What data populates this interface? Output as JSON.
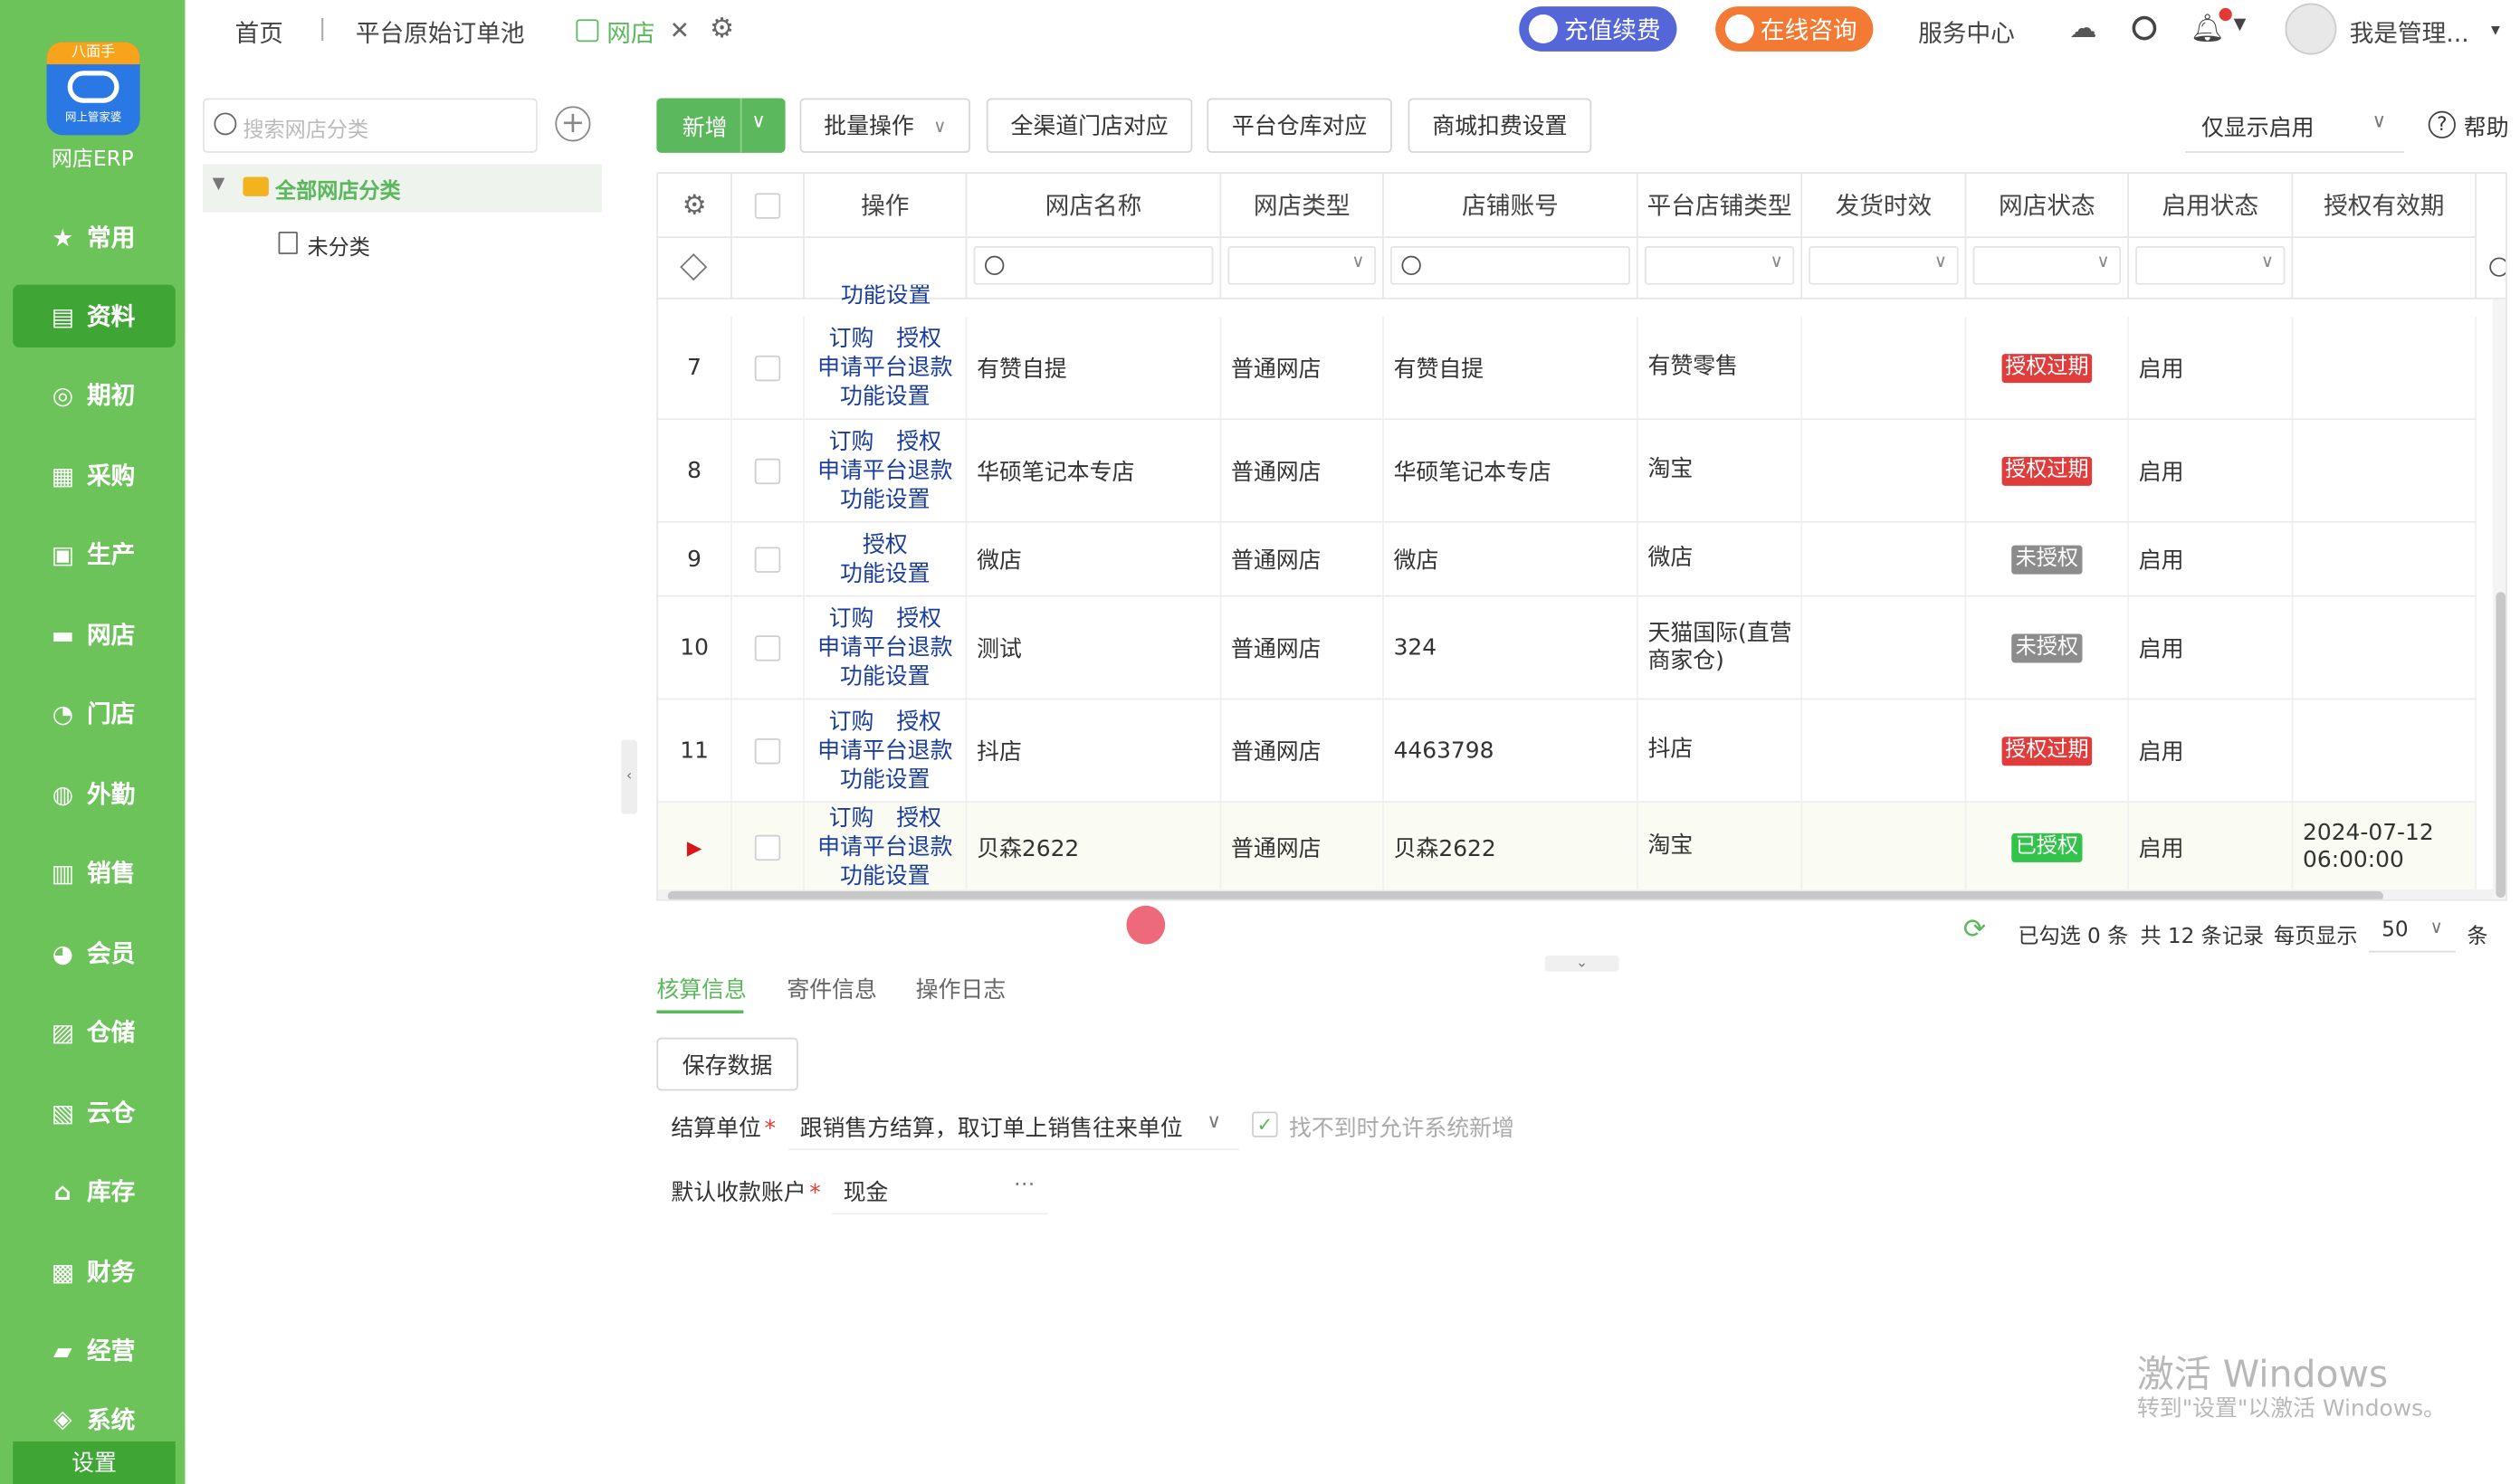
{
  "app": {
    "badge": "八面手",
    "logo_sub": "网上管家婆",
    "title": "网店ERP"
  },
  "sidebar": {
    "items": [
      "常用",
      "资料",
      "期初",
      "采购",
      "生产",
      "网店",
      "门店",
      "外勤",
      "销售",
      "会员",
      "仓储",
      "云仓",
      "库存",
      "财务",
      "经营",
      "系统"
    ],
    "settings": "设置"
  },
  "topbar": {
    "home": "首页",
    "tab_orders": "平台原始订单池",
    "tab_shop": "网店",
    "recharge": "充值续费",
    "consult": "在线咨询",
    "service": "服务中心",
    "user": "我是管理..."
  },
  "tree": {
    "search_placeholder": "搜索网店分类",
    "root": "全部网店分类",
    "child": "未分类"
  },
  "toolbar": {
    "add": "新增",
    "batch": "批量操作",
    "map_store": "全渠道门店对应",
    "map_warehouse": "平台仓库对应",
    "mall_fee": "商城扣费设置",
    "filter_select": "仅显示启用",
    "help": "帮助"
  },
  "columns": [
    "操作",
    "网店名称",
    "网店类型",
    "店铺账号",
    "平台店铺类型",
    "发货时效",
    "网店状态",
    "启用状态",
    "授权有效期"
  ],
  "partial_row_text": "功能设置",
  "rows": [
    {
      "no": "7",
      "ops": [
        "订购",
        "授权",
        "申请平台退款",
        "功能设置"
      ],
      "name": "有赞自提",
      "type": "普通网店",
      "account": "有赞自提",
      "platform": "有赞零售",
      "status": "授权过期",
      "enabled": "启用",
      "expiry": ""
    },
    {
      "no": "8",
      "ops": [
        "订购",
        "授权",
        "申请平台退款",
        "功能设置"
      ],
      "name": "华硕笔记本专店",
      "type": "普通网店",
      "account": "华硕笔记本专店",
      "platform": "淘宝",
      "status": "授权过期",
      "enabled": "启用",
      "expiry": ""
    },
    {
      "no": "9",
      "ops": [
        "",
        "授权",
        "",
        "功能设置"
      ],
      "name": "微店",
      "type": "普通网店",
      "account": "微店",
      "platform": "微店",
      "status": "未授权",
      "enabled": "启用",
      "expiry": ""
    },
    {
      "no": "10",
      "ops": [
        "订购",
        "授权",
        "申请平台退款",
        "功能设置"
      ],
      "name": "测试",
      "type": "普通网店",
      "account": "324",
      "platform": "天猫国际(直营商家仓)",
      "status": "未授权",
      "enabled": "启用",
      "expiry": ""
    },
    {
      "no": "11",
      "ops": [
        "订购",
        "授权",
        "申请平台退款",
        "功能设置"
      ],
      "name": "抖店",
      "type": "普通网店",
      "account": "4463798",
      "platform": "抖店",
      "status": "授权过期",
      "enabled": "启用",
      "expiry": ""
    },
    {
      "no": "",
      "ops": [
        "订购",
        "授权",
        "申请平台退款",
        "功能设置"
      ],
      "name": "贝森2622",
      "type": "普通网店",
      "account": "贝森2622",
      "platform": "淘宝",
      "status": "已授权",
      "enabled": "启用",
      "expiry": "2024-07-12 06:00:00"
    }
  ],
  "footer": {
    "selected": "已勾选 0 条",
    "total": "共 12 条记录",
    "per_page_label": "每页显示",
    "per_page": "50",
    "unit": "条"
  },
  "tabs": [
    "核算信息",
    "寄件信息",
    "操作日志"
  ],
  "form": {
    "save": "保存数据",
    "settle_label": "结算单位",
    "settle_value": "跟销售方结算，取订单上销售往来单位",
    "allow_new": "找不到时允许系统新增",
    "account_label": "默认收款账户",
    "account_value": "现金",
    "required_mark": "*"
  },
  "watermark": {
    "line1": "激活 Windows",
    "line2": "转到\"设置\"以激活 Windows。"
  },
  "colors": {
    "sidebar": "#6cc35a",
    "sidebar_active": "#3fa535",
    "accent": "#5cb85c",
    "expired": "#e03c3c",
    "unauth": "#8c8c8c",
    "authorized": "#33c24a",
    "link": "#1b3e9e"
  }
}
